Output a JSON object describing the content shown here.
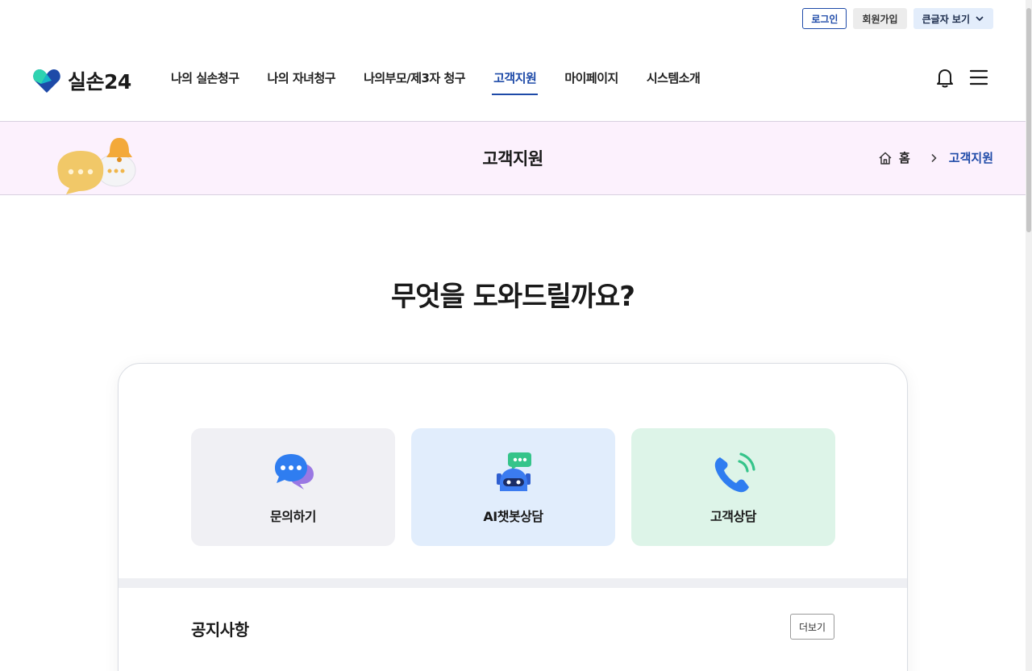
{
  "util": {
    "login": "로그인",
    "join": "회원가입",
    "big_text": "큰글자 보기"
  },
  "header": {
    "logo_text": "실손24",
    "nav": [
      {
        "label": "나의 실손청구"
      },
      {
        "label": "나의 자녀청구"
      },
      {
        "label": "나의부모/제3자 청구"
      },
      {
        "label": "고객지원",
        "active": true
      },
      {
        "label": "마이페이지"
      },
      {
        "label": "시스템소개"
      }
    ],
    "icons": [
      "bell-icon",
      "menu-icon"
    ]
  },
  "banner": {
    "title": "고객지원",
    "breadcrumb": {
      "home": "홈",
      "current": "고객지원"
    }
  },
  "main": {
    "heading": "무엇을 도와드릴까요?",
    "cards": [
      {
        "label": "문의하기",
        "icon": "chat-bubbles-icon"
      },
      {
        "label": "AI챗봇상담",
        "icon": "robot-icon"
      },
      {
        "label": "고객상담",
        "icon": "phone-icon"
      }
    ],
    "notice": {
      "title": "공지사항",
      "more": "더보기"
    }
  },
  "colors": {
    "accent": "#1e4aa8",
    "banner_bg": "#fcf1fd",
    "card_inquiry": "#f0f0f4",
    "card_chatbot": "#e1edfc",
    "card_counsel": "#ddf4e8"
  }
}
